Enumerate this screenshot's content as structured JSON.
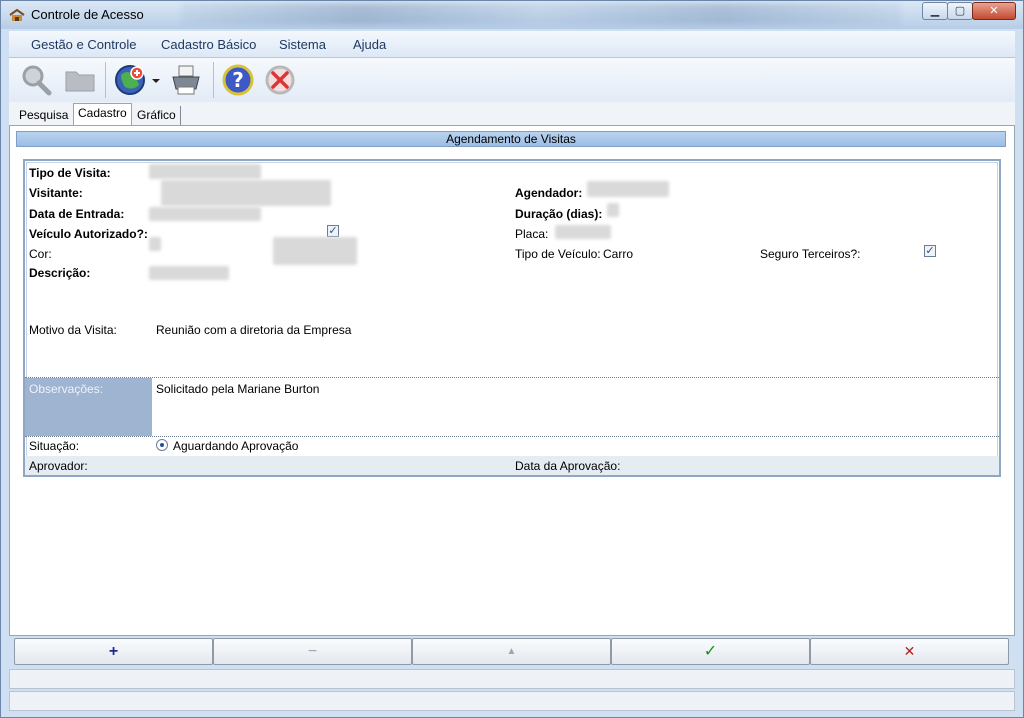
{
  "window": {
    "title": "Controle de Acesso",
    "controls": {
      "minimize": "▁",
      "maximize": "▢",
      "close": "✕"
    }
  },
  "menu": [
    "Gestão e Controle",
    "Cadastro Básico",
    "Sistema",
    "Ajuda"
  ],
  "toolbar": {
    "icons": [
      "search-icon",
      "folder-icon",
      "globe-add-icon",
      "dropdown-arrow-icon",
      "printer-icon",
      "help-icon",
      "cancel-icon"
    ]
  },
  "tabs": [
    "Pesquisa",
    "Cadastro",
    "Gráfico"
  ],
  "active_tab": "Cadastro",
  "section_title": "Agendamento de Visitas",
  "form": {
    "tipo_visita_label": "Tipo de Visita:",
    "visitante_label": "Visitante:",
    "data_entrada_label": "Data de Entrada:",
    "veiculo_autorizado_label": "Veículo Autorizado?:",
    "veiculo_autorizado_checked": true,
    "cor_label": "Cor:",
    "descricao_label": "Descrição:",
    "agendador_label": "Agendador:",
    "duracao_label": "Duração (dias):",
    "placa_label": "Placa:",
    "tipo_veiculo_label": "Tipo de Veículo:",
    "tipo_veiculo_value": "Carro",
    "seguro_label": "Seguro Terceiros?:",
    "seguro_checked": true,
    "motivo_label": "Motivo da Visita:",
    "motivo_value": "Reunião com a diretoria da Empresa",
    "observacoes_label": "Observações:",
    "observacoes_value": "Solicitado pela Mariane Burton",
    "situacao_label": "Situação:",
    "situacao_value": "Aguardando Aprovação",
    "aprovador_label": "Aprovador:",
    "data_aprovacao_label": "Data da Aprovação:",
    "check_mark": "✓"
  },
  "buttons": {
    "add": "+",
    "remove": "−",
    "up": "▲",
    "confirm": "✓",
    "cancel": "✕"
  },
  "colors": {
    "confirm": "#1a8f1a",
    "cancel": "#b51f1f",
    "add": "#1b2f8a",
    "disabled": "#a0a6ad"
  }
}
